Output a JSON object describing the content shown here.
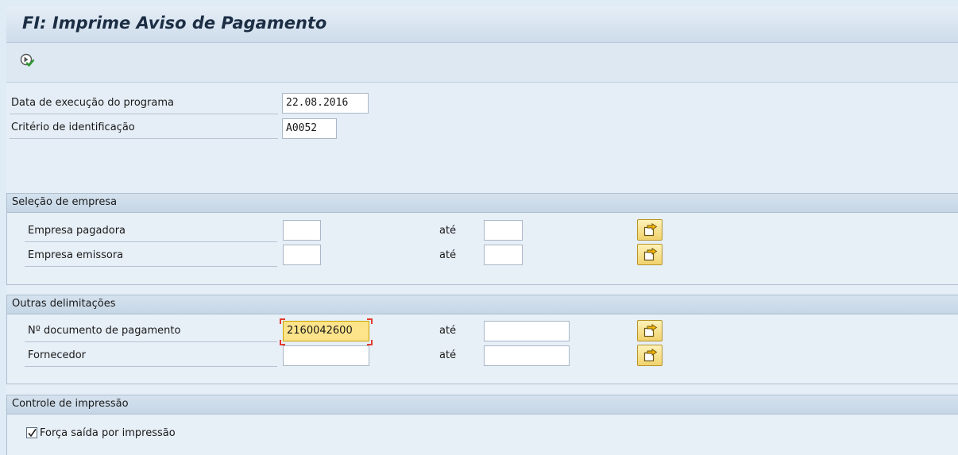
{
  "window": {
    "title": "FI: Imprime Aviso de Pagamento"
  },
  "toolbar": {
    "execute_icon": "execute-icon"
  },
  "params": {
    "run_date_label": "Data de execução do programa",
    "run_date_value": "22.08.2016",
    "identification_label": "Critério de identificação",
    "identification_value": "A0052"
  },
  "company_selection": {
    "title": "Seleção de empresa",
    "rows": [
      {
        "label": "Empresa pagadora",
        "from": "",
        "to_label": "até",
        "to": ""
      },
      {
        "label": "Empresa emissora",
        "from": "",
        "to_label": "até",
        "to": ""
      }
    ]
  },
  "other_limits": {
    "title": "Outras delimitações",
    "rows": [
      {
        "label": "Nº documento de pagamento",
        "from": "2160042600",
        "to_label": "até",
        "to": ""
      },
      {
        "label": "Fornecedor",
        "from": "",
        "to_label": "até",
        "to": ""
      }
    ]
  },
  "print_control": {
    "title": "Controle de impressão",
    "force_print_label": "Força saída por impressão",
    "force_print_checked": true
  },
  "colors": {
    "focus_field": "#fde48a",
    "focus_corner": "#e23b2e",
    "header_text": "#1c2e44"
  },
  "icons": {
    "multiple_selection": "multiple-selection-icon",
    "checkmark": "checkmark-icon"
  }
}
